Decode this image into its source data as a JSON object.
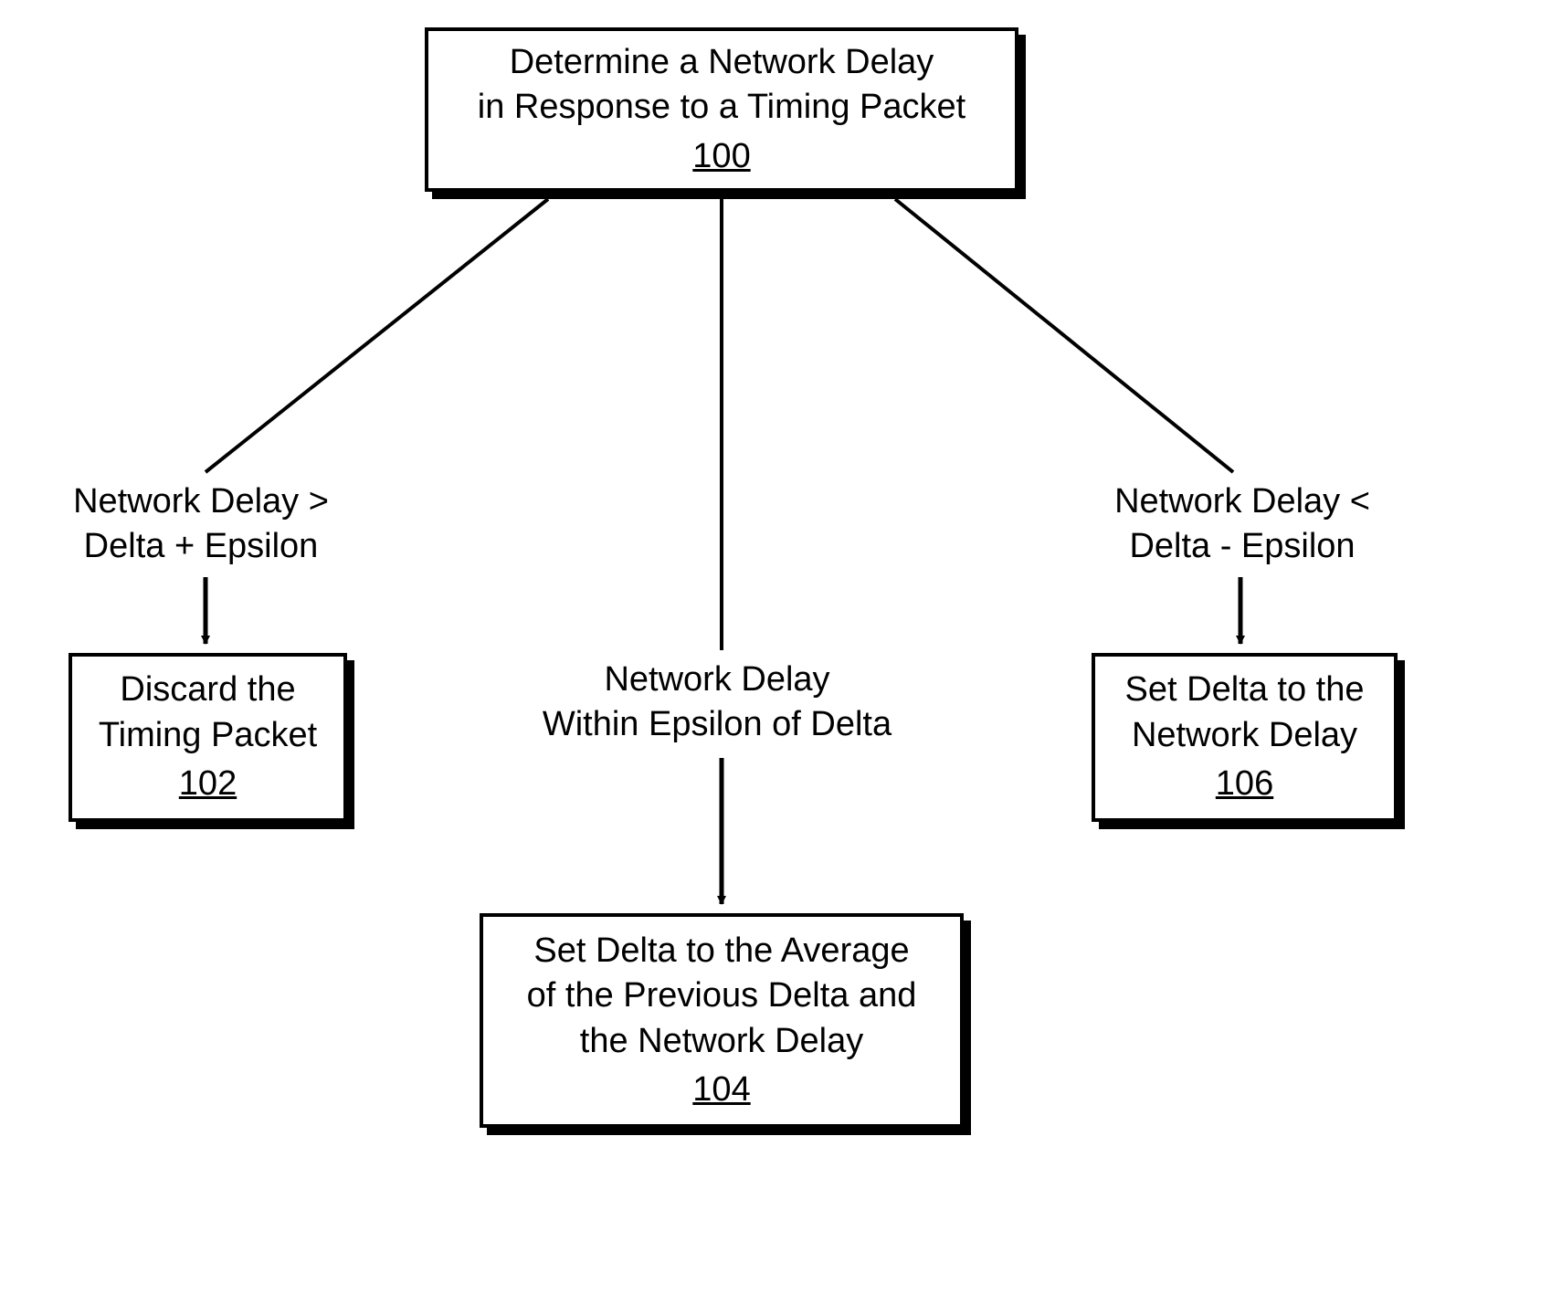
{
  "topBox": {
    "line1": "Determine a Network Delay",
    "line2": "in Response to a Timing Packet",
    "num": "100"
  },
  "leftLabel": {
    "line1": "Network Delay  >",
    "line2": "Delta + Epsilon"
  },
  "leftBox": {
    "line1": "Discard the",
    "line2": "Timing Packet",
    "num": "102"
  },
  "midLabel": {
    "line1": "Network Delay",
    "line2": "Within Epsilon of Delta"
  },
  "midBox": {
    "line1": "Set Delta to the Average",
    "line2": "of the Previous Delta and",
    "line3": "the Network Delay",
    "num": "104"
  },
  "rightLabel": {
    "line1": "Network Delay  <",
    "line2": "Delta - Epsilon"
  },
  "rightBox": {
    "line1": "Set Delta to the",
    "line2": "Network Delay",
    "num": "106"
  }
}
